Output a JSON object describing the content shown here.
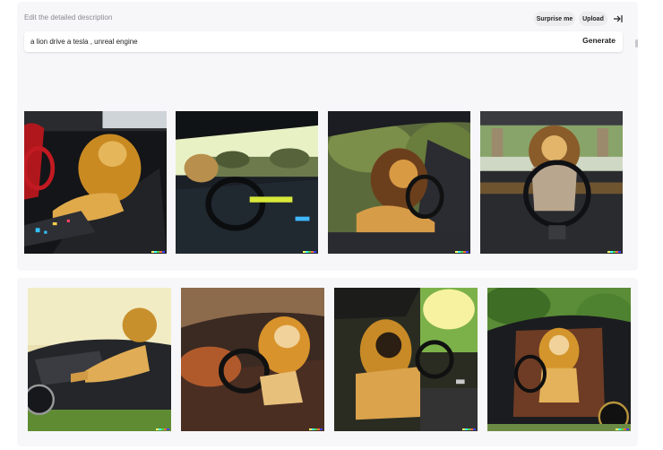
{
  "header": {
    "hint": "Edit the detailed description",
    "surprise_label": "Surprise me",
    "upload_label": "Upload"
  },
  "prompt": {
    "value": "a lion drive a tesla , unreal engine",
    "generate_label": "Generate"
  },
  "colors": {
    "panel_bg": "#f7f7f9",
    "pill_bg": "#ececef",
    "lion_mane": "#c98a22",
    "lion_fur": "#e0a94a"
  },
  "results": {
    "rows": [
      {
        "images": [
          {
            "name": "lion-on-seat-dark-interior"
          },
          {
            "name": "tesla-cockpit-sunset-road"
          },
          {
            "name": "lion-driver-side-window"
          },
          {
            "name": "lion-front-view-steering"
          }
        ]
      },
      {
        "images": [
          {
            "name": "lion-lounging-black-car-grass"
          },
          {
            "name": "lion-roaring-interior-sunlight"
          },
          {
            "name": "lion-seated-dashboard-sunset"
          },
          {
            "name": "lion-open-door-garden"
          }
        ]
      }
    ]
  }
}
